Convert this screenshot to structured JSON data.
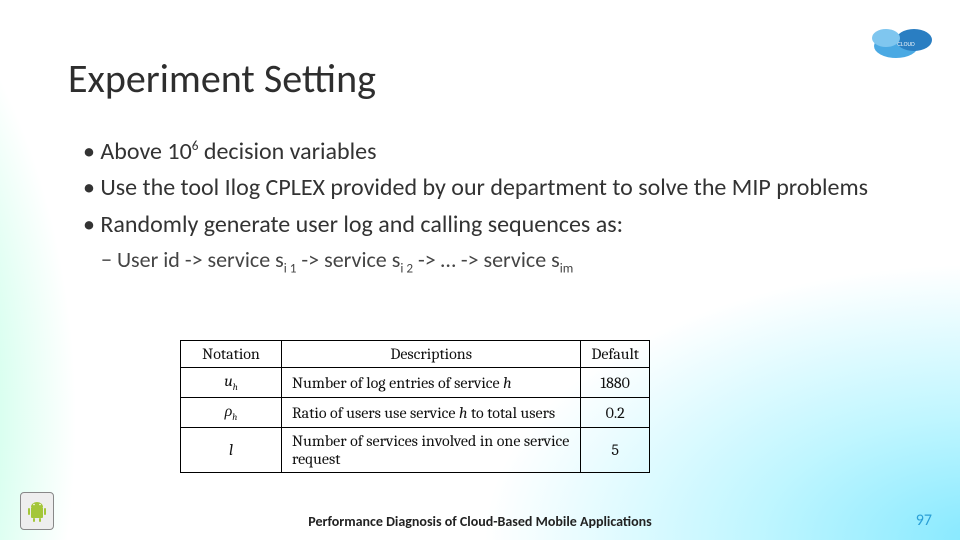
{
  "title": "Experiment Setting",
  "bullets": [
    {
      "prefix": "Above 10",
      "exp": "6",
      "rest": " decision variables"
    },
    {
      "text": "Use the tool Ilog CPLEX provided by our department to solve the MIP problems"
    },
    {
      "text": "Randomly generate user log and calling sequences as:"
    }
  ],
  "sub": {
    "p0": "User id -> service s",
    "s0": "i 1",
    "p1": " -> service s",
    "s1": "i 2",
    "p2": " -> … -> service s",
    "s2": "im"
  },
  "table": {
    "headers": [
      "Notation",
      "Descriptions",
      "Default"
    ],
    "rows": [
      {
        "sym": "u",
        "sub": "h",
        "d0": "Number of log entries of service",
        "it": "h",
        "def": "1880"
      },
      {
        "sym": "ρ",
        "sub": "h",
        "d0": "Ratio of users use service",
        "it": "h",
        "d1": "to total users",
        "def": "0.2"
      },
      {
        "sym": "l",
        "d0": "Number of services involved in one service request",
        "def": "5"
      }
    ]
  },
  "footer": "Performance Diagnosis of Cloud-Based Mobile Applications",
  "page": "97"
}
